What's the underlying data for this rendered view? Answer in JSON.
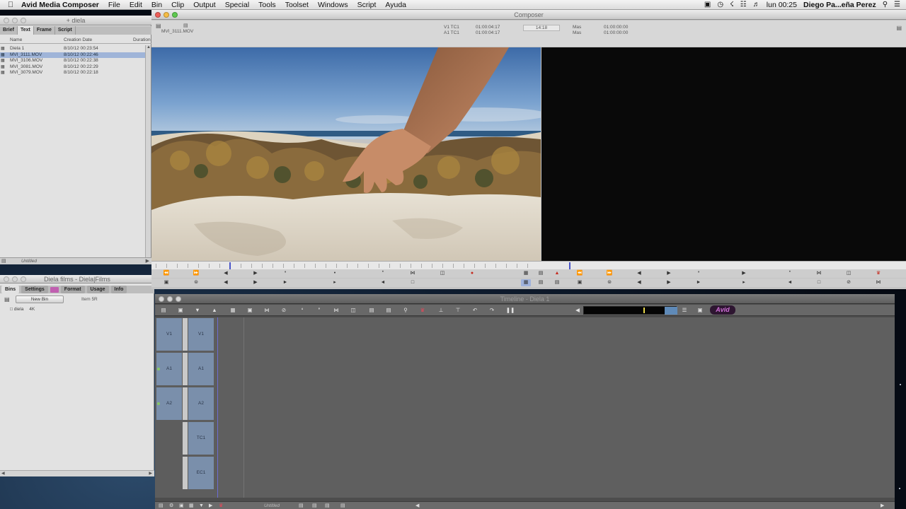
{
  "menubar": {
    "app_name": "Avid Media Composer",
    "menus": [
      "File",
      "Edit",
      "Bin",
      "Clip",
      "Output",
      "Special",
      "Tools",
      "Toolset",
      "Windows",
      "Script",
      "Ayuda"
    ],
    "clock": "lun 00:25",
    "user": "Diego Pa...eña Perez"
  },
  "bin": {
    "title": "+ diela",
    "tabs": [
      "Brief",
      "Text",
      "Frame",
      "Script"
    ],
    "active_tab": "Text",
    "columns": [
      "Name",
      "Creation Date",
      "Duration"
    ],
    "rows": [
      {
        "name": "Diela 1",
        "date": "8/10/12 00:23:54",
        "selected": false
      },
      {
        "name": "MVI_3111.MOV",
        "date": "8/10/12 00:22:46",
        "selected": true
      },
      {
        "name": "MVI_3106.MOV",
        "date": "8/10/12 00:22:38",
        "selected": false
      },
      {
        "name": "MVI_3081.MOV",
        "date": "8/10/12 00:22:29",
        "selected": false
      },
      {
        "name": "MVI_3079.MOV",
        "date": "8/10/12 00:22:18",
        "selected": false
      }
    ],
    "footer_label": "Untitled"
  },
  "project": {
    "title": "Diela films - Diela|Films",
    "tabs": [
      "Bins",
      "Settings",
      "Format",
      "Usage",
      "Info"
    ],
    "new_bin_label": "New Bin",
    "item_count": "Item 5R",
    "items": [
      {
        "name": "diela",
        "size": "4K"
      }
    ]
  },
  "composer": {
    "title": "Composer",
    "source_clip": "MVI_3111.MOV",
    "source_tc_label": "V1 TC1",
    "source_tc": "01:00:04:17",
    "source_tc_label2": "A1 TC1",
    "source_tc2": "01:00:04:17",
    "center_tc": "14:18",
    "record_mas_label": "Mas",
    "record_tc": "01:00:00:00",
    "record_mas_label2": "Mas",
    "record_tc2": "01:00:00:00"
  },
  "timeline": {
    "title": "Timeline - Diela 1",
    "logo": "Avid",
    "tracks": [
      {
        "src": "V1",
        "rec": "V1"
      },
      {
        "src": "A1",
        "rec": "A1"
      },
      {
        "src": "A2",
        "rec": "A2"
      },
      {
        "src": "",
        "rec": "TC1"
      },
      {
        "src": "",
        "rec": "EC1"
      }
    ],
    "bottom_label": "Untitled"
  },
  "colors": {
    "accent_blue": "#9fb4d8",
    "track_blue": "#7a8fab",
    "avid_purple": "#d070d8",
    "record_red": "#c62a1e"
  }
}
